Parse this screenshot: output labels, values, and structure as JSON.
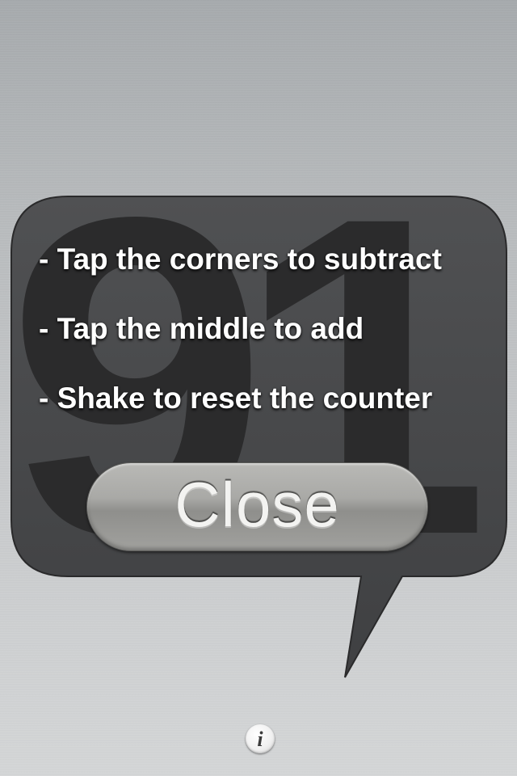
{
  "help_overlay": {
    "counter_value": "91",
    "instructions": [
      "- Tap the corners to subtract",
      "- Tap the middle to add",
      "- Shake to reset the counter"
    ],
    "close_label": "Close",
    "info_icon": "i"
  },
  "colors": {
    "bubble_fill": "#4a4b4d",
    "counter_digits": "#2b2b2c",
    "instruction_text": "#ffffff",
    "close_button": "#a9a9a6"
  },
  "icons": {
    "info": "info-icon"
  }
}
